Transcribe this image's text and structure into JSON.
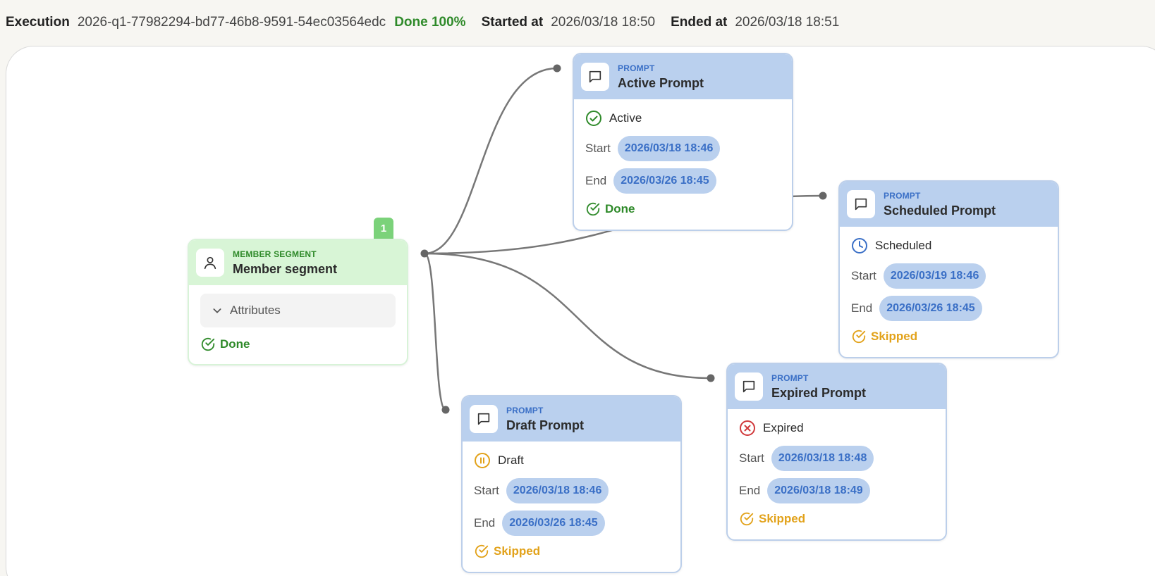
{
  "header": {
    "execution_label": "Execution",
    "execution_id": "2026-q1-77982294-bd77-46b8-9591-54ec03564edc",
    "status": "Done 100%",
    "started_label": "Started at",
    "started_value": "2026/03/18 18:50",
    "ended_label": "Ended at",
    "ended_value": "2026/03/18 18:51"
  },
  "segment": {
    "kind": "MEMBER SEGMENT",
    "title": "Member segment",
    "attributes_label": "Attributes",
    "result": "Done",
    "badge_count": "1",
    "icon": "person-icon"
  },
  "prompts": {
    "active": {
      "kind": "PROMPT",
      "title": "Active Prompt",
      "status": "Active",
      "start_label": "Start",
      "start": "2026/03/18 18:46",
      "end_label": "End",
      "end": "2026/03/26 18:45",
      "result": "Done"
    },
    "scheduled": {
      "kind": "PROMPT",
      "title": "Scheduled Prompt",
      "status": "Scheduled",
      "start_label": "Start",
      "start": "2026/03/19 18:46",
      "end_label": "End",
      "end": "2026/03/26 18:45",
      "result": "Skipped"
    },
    "expired": {
      "kind": "PROMPT",
      "title": "Expired Prompt",
      "status": "Expired",
      "start_label": "Start",
      "start": "2026/03/18 18:48",
      "end_label": "End",
      "end": "2026/03/18 18:49",
      "result": "Skipped"
    },
    "draft": {
      "kind": "PROMPT",
      "title": "Draft Prompt",
      "status": "Draft",
      "start_label": "Start",
      "start": "2026/03/18 18:46",
      "end_label": "End",
      "end": "2026/03/26 18:45",
      "result": "Skipped"
    }
  },
  "colors": {
    "done_green": "#2f8a2a",
    "skipped_orange": "#e2a21a",
    "expired_red": "#d0393b",
    "scheduled_blue": "#3a6fc6",
    "prompt_header": "#bad0ee",
    "segment_header": "#d8f5d6"
  }
}
